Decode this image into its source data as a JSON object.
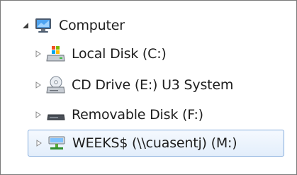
{
  "tree": {
    "root": {
      "label": "Computer",
      "expanded": true,
      "icon": "computer-icon"
    },
    "items": [
      {
        "label": "Local Disk (C:)",
        "icon": "local-disk-icon",
        "expanded": false
      },
      {
        "label": "CD Drive (E:) U3 System",
        "icon": "cd-drive-icon",
        "expanded": false
      },
      {
        "label": "Removable Disk (F:)",
        "icon": "removable-disk-icon",
        "expanded": false
      },
      {
        "label": "WEEKS$ (\\\\cuasentj) (M:)",
        "icon": "network-drive-icon",
        "expanded": false,
        "selected": true
      }
    ]
  },
  "colors": {
    "selection_border": "#84acdd",
    "selection_fill": "#e3eefb",
    "text": "#1e1e1e",
    "frame_border": "#7a7a7a"
  }
}
